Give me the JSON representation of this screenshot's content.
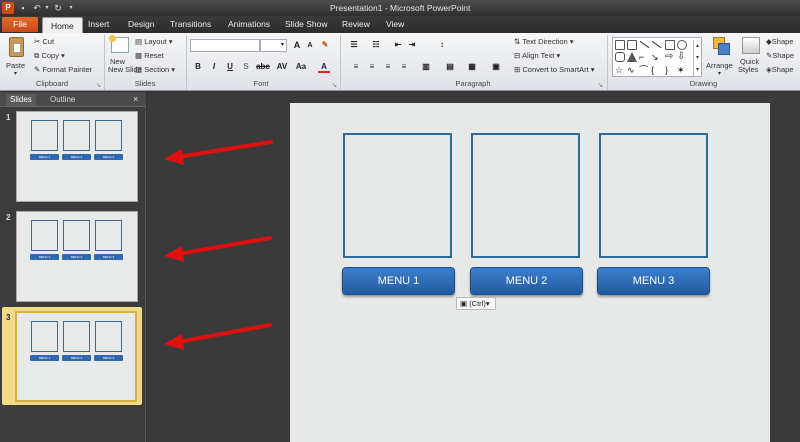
{
  "window": {
    "title": "Presentation1 - Microsoft PowerPoint"
  },
  "tabs": [
    "File",
    "Home",
    "Insert",
    "Design",
    "Transitions",
    "Animations",
    "Slide Show",
    "Review",
    "View"
  ],
  "clipboard": {
    "paste": "Paste",
    "cut": "Cut",
    "copy": "Copy",
    "format_painter": "Format Painter",
    "label": "Clipboard"
  },
  "slides_group": {
    "new_slide": "New Slide",
    "layout": "Layout",
    "reset": "Reset",
    "section": "Section",
    "label": "Slides"
  },
  "font_group": {
    "label": "Font",
    "bold": "B",
    "italic": "I",
    "underline": "U",
    "strike": "S",
    "abc": "abc",
    "spacing": "AV",
    "case": "Aa",
    "grow": "A",
    "shrink": "A"
  },
  "paragraph_group": {
    "label": "Paragraph",
    "text_direction": "Text Direction",
    "align_text": "Align Text",
    "convert_smartart": "Convert to SmartArt"
  },
  "drawing_group": {
    "label": "Drawing",
    "arrange": "Arrange",
    "quick_styles_line1": "Quick",
    "quick_styles_line2": "Styles",
    "shape1": "Shape",
    "shape2": "Shape",
    "shape3": "Shape"
  },
  "left_panel": {
    "tab_slides": "Slides",
    "tab_outline": "Outline",
    "close": "×",
    "slides": [
      {
        "number": "1",
        "menus": [
          "MENU 1",
          "MENU 2",
          "MENU 3"
        ]
      },
      {
        "number": "2",
        "menus": [
          "MENU 1",
          "MENU 2",
          "MENU 3"
        ]
      },
      {
        "number": "3",
        "menus": [
          "MENU 1",
          "MENU 2",
          "MENU 3"
        ]
      }
    ]
  },
  "slide": {
    "menus": [
      "MENU 1",
      "MENU 2",
      "MENU 3"
    ],
    "paste_options": "(Ctrl)"
  },
  "colors": {
    "accent_blue": "#2f68b0",
    "arrow_red": "#e01010",
    "file_tab": "#d2541f",
    "selected_thumb": "#d8b044"
  }
}
